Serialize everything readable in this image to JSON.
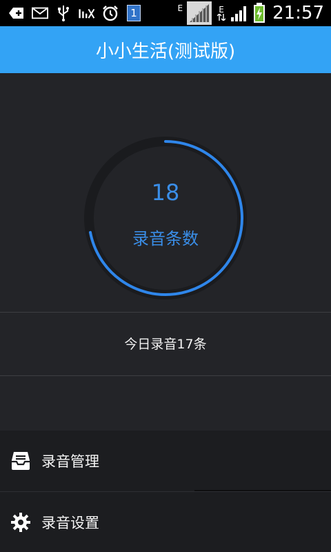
{
  "status_bar": {
    "time": "21:57",
    "notification_badge": "1",
    "network_e1": "E",
    "network_e2": "E",
    "left_icons": [
      "back-plus-icon",
      "mail-icon",
      "usb-icon",
      "no-signal-icon",
      "alarm-icon"
    ],
    "right_icons": [
      "sim-card-icon",
      "signal-icon",
      "data-transfer-icon",
      "signal-bars-icon",
      "battery-charging-icon"
    ]
  },
  "header": {
    "title": "小小生活(测试版)",
    "color": "#33a3f5"
  },
  "stats": {
    "count": "18",
    "count_label": "录音条数",
    "progress": 0.72,
    "accent": "#2f86ea",
    "today_text": "今日录音17条"
  },
  "menu": {
    "items": [
      {
        "label": "录音管理",
        "icon": "inbox-icon"
      },
      {
        "label": "录音设置",
        "icon": "gear-icon"
      }
    ]
  }
}
